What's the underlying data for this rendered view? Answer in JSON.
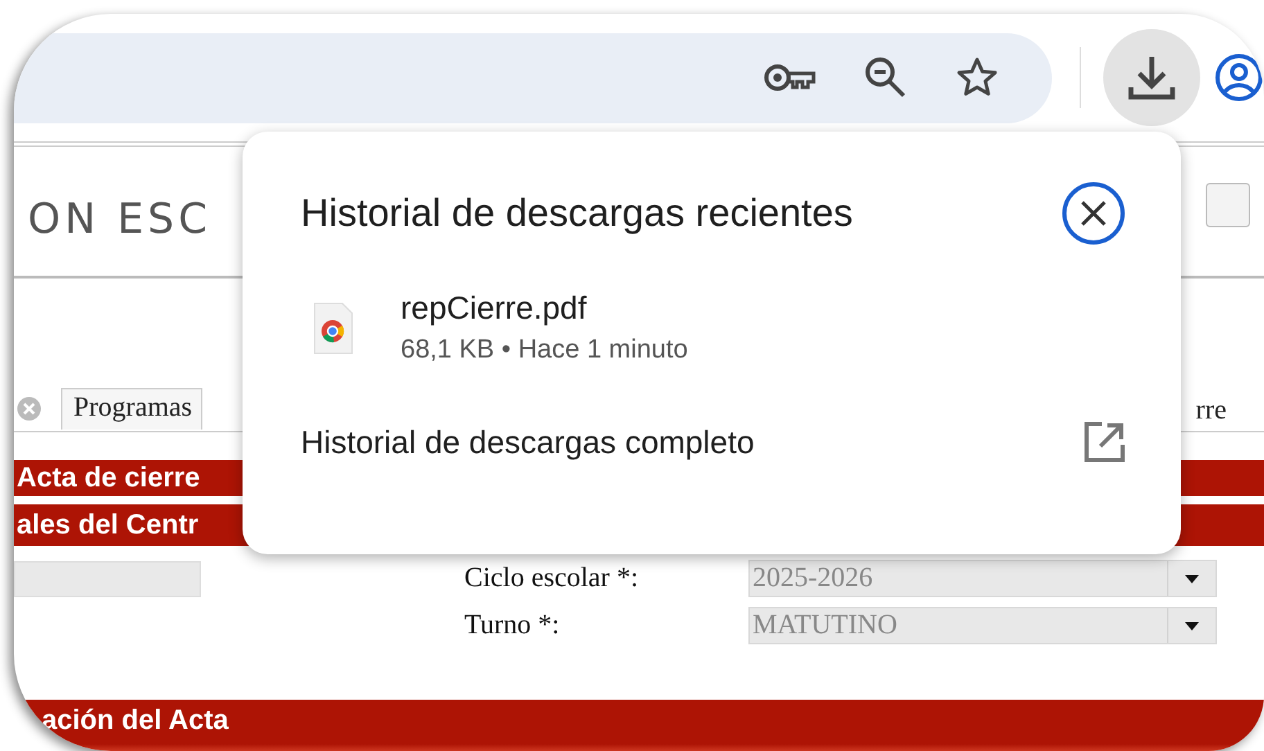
{
  "toolbar": {
    "downloads_button": {
      "active": true
    }
  },
  "page": {
    "header": "ON ESC",
    "tabs": [
      {
        "label": "Programas"
      },
      {
        "label": "rre"
      }
    ],
    "section_bars": [
      "Acta de cierre",
      "ales del Centr"
    ],
    "form_fields": [
      {
        "label": "Ciclo escolar *:",
        "value": "2025-2026"
      },
      {
        "label": "Turno *:",
        "value": "MATUTINO"
      }
    ],
    "footer_bar": "ación del Acta"
  },
  "downloads_popup": {
    "title": "Historial de descargas recientes",
    "items": [
      {
        "name": "repCierre.pdf",
        "details": "68,1 KB • Hace 1 minuto"
      }
    ],
    "full_history_link": "Historial de descargas completo"
  }
}
